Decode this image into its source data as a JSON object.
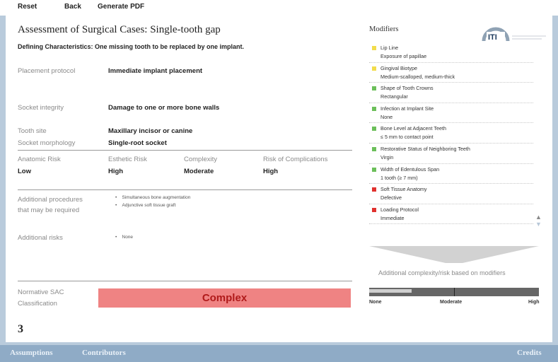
{
  "toolbar": {
    "reset": "Reset",
    "back": "Back",
    "generate_pdf": "Generate PDF"
  },
  "assessment": {
    "title": "Assessment of Surgical Cases: Single-tooth gap",
    "defining": "Defining Characteristics: One missing tooth to be replaced by one implant.",
    "rows": {
      "placement_label": "Placement protocol",
      "placement_value": "Immediate implant placement",
      "socket_integrity_label": "Socket integrity",
      "socket_integrity_value": "Damage to one or more bone walls",
      "tooth_site_label": "Tooth site",
      "tooth_site_value": "Maxillary incisor or canine",
      "socket_morph_label": "Socket morphology",
      "socket_morph_value": "Single-root socket"
    },
    "risks": {
      "anatomic_label": "Anatomic Risk",
      "anatomic_value": "Low",
      "esthetic_label": "Esthetic Risk",
      "esthetic_value": "High",
      "complexity_label": "Complexity",
      "complexity_value": "Moderate",
      "complications_label": "Risk of Complications",
      "complications_value": "High"
    },
    "additional_procedures_label_1": "Additional procedures",
    "additional_procedures_label_2": "that may be required",
    "additional_procedures": [
      "Simultaneous bone augmentation",
      "Adjunctive soft tissue graft"
    ],
    "additional_risks_label": "Additional risks",
    "additional_risks": [
      "None"
    ],
    "normative_label_1": "Normative SAC",
    "normative_label_2": "Classification",
    "classification": "Complex",
    "page_number": "3"
  },
  "modifiers": {
    "title": "Modifiers",
    "logo_text": "ITI",
    "items": [
      {
        "name": "Lip Line",
        "value": "Exposure of papillae",
        "color": "#f2dc4c"
      },
      {
        "name": "Gingival Biotype",
        "value": "Medium-scalloped, medium-thick",
        "color": "#f2dc4c"
      },
      {
        "name": "Shape of Tooth Crowns",
        "value": "Rectangular",
        "color": "#6cbf5a"
      },
      {
        "name": "Infection at Implant Site",
        "value": "None",
        "color": "#6cbf5a"
      },
      {
        "name": "Bone Level at Adjacent Teeth",
        "value": "≤ 5 mm to contact point",
        "color": "#6cbf5a"
      },
      {
        "name": "Restorative Status of Neighboring Teeth",
        "value": "Virgin",
        "color": "#6cbf5a"
      },
      {
        "name": "Width of Edentulous Span",
        "value": "1 tooth (≥ 7 mm)",
        "color": "#6cbf5a"
      },
      {
        "name": "Soft Tissue Anatomy",
        "value": "Defective",
        "color": "#e0312e"
      },
      {
        "name": "Loading Protocol",
        "value": "Immediate",
        "color": "#e0312e"
      }
    ],
    "additional_complexity": "Additional complexity/risk based on modifiers",
    "meter_level": 0.25,
    "meter_labels": {
      "none": "None",
      "moderate": "Moderate",
      "high": "High"
    }
  },
  "footer": {
    "assumptions": "Assumptions",
    "contributors": "Contributors",
    "credits": "Credits"
  }
}
